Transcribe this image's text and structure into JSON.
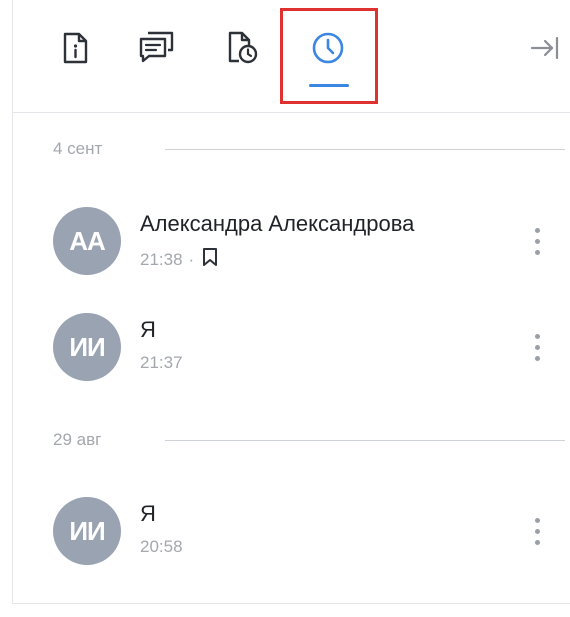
{
  "tabs": [
    {
      "id": "info",
      "icon": "document-info-icon"
    },
    {
      "id": "comments",
      "icon": "chat-bubbles-icon"
    },
    {
      "id": "document-history",
      "icon": "document-clock-icon"
    },
    {
      "id": "history",
      "icon": "clock-icon",
      "active": true
    }
  ],
  "header": {
    "collapse_icon": "collapse-panel-icon"
  },
  "colors": {
    "accent": "#3a86e0",
    "highlight": "#e03131",
    "avatar_bg": "#9aa3b2"
  },
  "groups": [
    {
      "date": "4 сент",
      "entries": [
        {
          "initials": "АА",
          "author": "Александра Александрова",
          "time": "21:38",
          "separator": "·",
          "bookmarked": true
        },
        {
          "initials": "ИИ",
          "author": "Я",
          "time": "21:37"
        }
      ]
    },
    {
      "date": "29 авг",
      "entries": [
        {
          "initials": "ИИ",
          "author": "Я",
          "time": "20:58"
        }
      ]
    }
  ]
}
